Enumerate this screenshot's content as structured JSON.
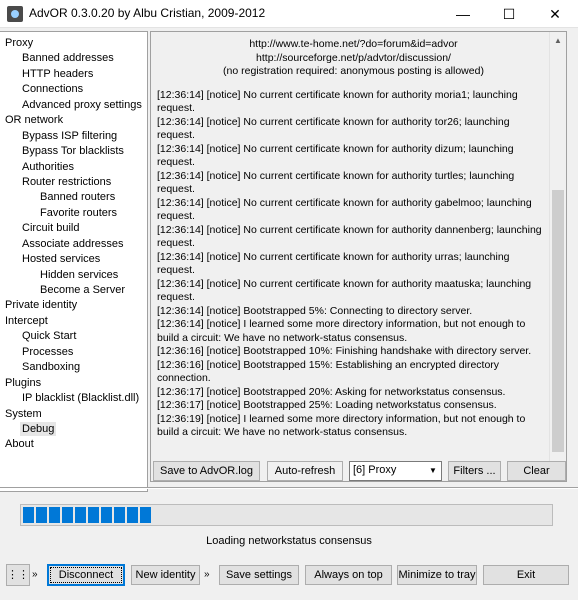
{
  "window": {
    "title": "AdvOR  0.3.0.20 by Albu Cristian, 2009-2012",
    "minimize": "—",
    "maximize": "☐",
    "close": "✕"
  },
  "tree": [
    {
      "label": "Proxy"
    },
    {
      "label": "Banned addresses"
    },
    {
      "label": "HTTP headers"
    },
    {
      "label": "Connections"
    },
    {
      "label": "Advanced proxy settings"
    },
    {
      "label": "OR network"
    },
    {
      "label": "Bypass ISP filtering"
    },
    {
      "label": "Bypass Tor blacklists"
    },
    {
      "label": "Authorities"
    },
    {
      "label": "Router restrictions"
    },
    {
      "label": "Banned routers"
    },
    {
      "label": "Favorite routers"
    },
    {
      "label": "Circuit build"
    },
    {
      "label": "Associate addresses"
    },
    {
      "label": "Hosted services"
    },
    {
      "label": "Hidden services"
    },
    {
      "label": "Become a Server"
    },
    {
      "label": "Private identity"
    },
    {
      "label": "Intercept"
    },
    {
      "label": "Quick Start"
    },
    {
      "label": "Processes"
    },
    {
      "label": "Sandboxing"
    },
    {
      "label": "Plugins"
    },
    {
      "label": "IP blacklist (Blacklist.dll)"
    },
    {
      "label": "System"
    },
    {
      "label": "Debug"
    },
    {
      "label": "About"
    }
  ],
  "log": {
    "header": [
      "http://www.te-home.net/?do=forum&id=advor",
      "http://sourceforge.net/p/advtor/discussion/",
      "(no registration required: anonymous posting is allowed)"
    ],
    "lines": [
      "[12:36:14] [notice] No current certificate known for authority moria1; launching request.",
      "[12:36:14] [notice] No current certificate known for authority tor26; launching request.",
      "[12:36:14] [notice] No current certificate known for authority dizum; launching request.",
      "[12:36:14] [notice] No current certificate known for authority turtles; launching request.",
      "[12:36:14] [notice] No current certificate known for authority gabelmoo; launching request.",
      "[12:36:14] [notice] No current certificate known for authority dannenberg; launching request.",
      "[12:36:14] [notice] No current certificate known for authority urras; launching request.",
      "[12:36:14] [notice] No current certificate known for authority maatuska; launching request.",
      "[12:36:14] [notice] Bootstrapped 5%: Connecting to directory server.",
      "[12:36:14] [notice] I learned some more directory information, but not enough to build a circuit: We have no network-status consensus.",
      "[12:36:16] [notice] Bootstrapped 10%: Finishing handshake with directory server.",
      "[12:36:16] [notice] Bootstrapped 15%: Establishing an encrypted directory connection.",
      "[12:36:17] [notice] Bootstrapped 20%: Asking for networkstatus consensus.",
      "[12:36:17] [notice] Bootstrapped 25%: Loading networkstatus consensus.",
      "[12:36:19] [notice] I learned some more directory information, but not enough to build a circuit: We have no network-status consensus."
    ]
  },
  "log_toolbar": {
    "save_label": "Save to AdvOR.log",
    "autorefresh_label": "Auto-refresh",
    "filter_value": "[6] Proxy",
    "filters_label": "Filters ...",
    "clear_label": "Clear"
  },
  "progress": {
    "fraction": 0.25,
    "blocks": 10
  },
  "status": {
    "text": "Loading networkstatus consensus"
  },
  "bottom_bar": {
    "chevron": "»",
    "disconnect_label": "Disconnect",
    "new_identity_label": "New identity",
    "save_settings_label": "Save settings",
    "always_on_top_label": "Always on top",
    "minimize_to_tray_label": "Minimize to tray",
    "exit_label": "Exit"
  },
  "colors": {
    "progress": "#0078d7",
    "focus": "#0078d7"
  }
}
